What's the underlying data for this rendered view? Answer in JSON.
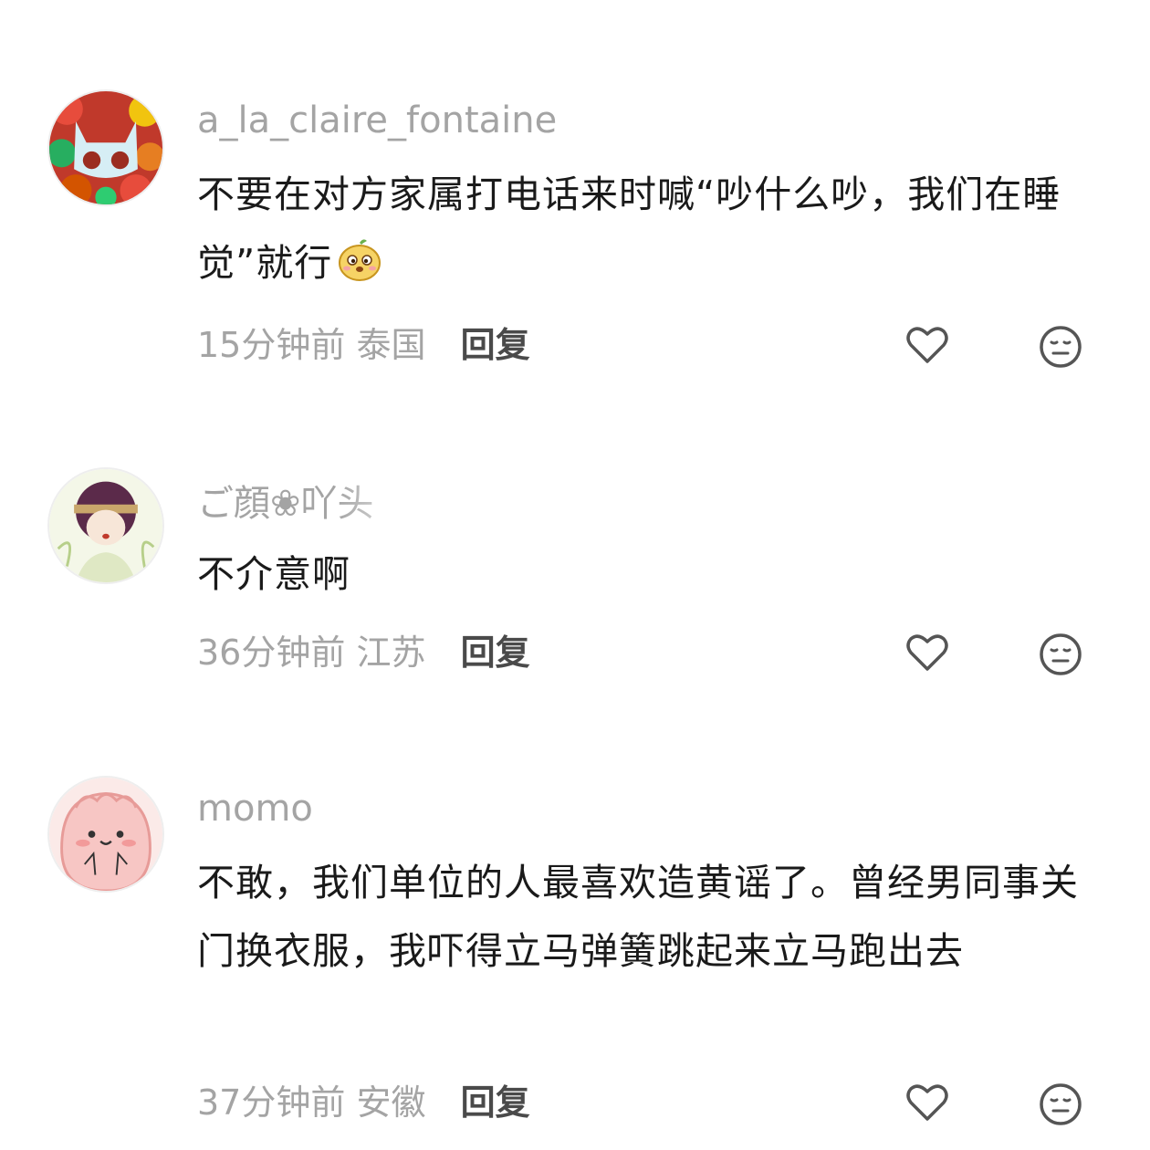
{
  "comments": [
    {
      "username": "a_la_claire_fontaine",
      "text": "不要在对方家属打电话来时喊“吵什么吵，我们在睡觉”就行",
      "time": "15分钟前",
      "location": "泰国",
      "reply_label": "回复",
      "avatar_icon": "cat-mask-flower-avatar",
      "inline_emoji": "smug-pear-emoji"
    },
    {
      "username": "ご顔❀吖头",
      "text": "不介意啊",
      "time": "36分钟前",
      "location": "江苏",
      "reply_label": "回复",
      "avatar_icon": "girl-illustration-avatar"
    },
    {
      "username": "momo",
      "text": "不敢，我们单位的人最喜欢造黄谣了。曾经男同事关门换衣服，我吓得立马弹簧跳起来立马跑出去",
      "time": "37分钟前",
      "location": "安徽",
      "reply_label": "回复",
      "avatar_icon": "pink-blob-avatar"
    }
  ],
  "colors": {
    "meta": "#a4a4a4",
    "text": "#1a1a1a",
    "reply": "#4a4a4a",
    "icon": "#555555"
  }
}
